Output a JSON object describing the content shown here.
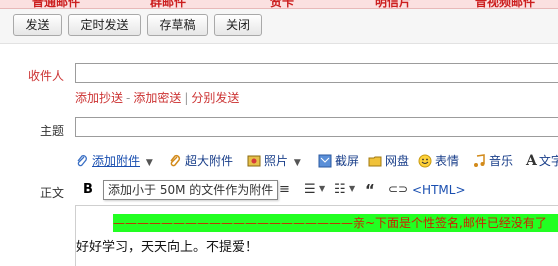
{
  "tabs": [
    "普通邮件",
    "群邮件",
    "贺卡",
    "明信片",
    "音视频邮件"
  ],
  "toolbar": {
    "send": "发送",
    "timed_send": "定时发送",
    "save_draft": "存草稿",
    "close": "关闭"
  },
  "form": {
    "recipient_label": "收件人",
    "add_cc": "添加抄送",
    "add_bcc": "添加密送",
    "separate_send": "分别发送",
    "subject_label": "主题",
    "body_label": "正文"
  },
  "attachments": {
    "add_attachment": "添加附件",
    "large_attachment": "超大附件",
    "photo": "照片",
    "screenshot": "截屏",
    "netdisk": "网盘",
    "emoji": "表情",
    "music": "音乐",
    "text": "文字"
  },
  "tooltip": "添加小于 50M 的文件作为附件",
  "editor": {
    "bold": "B",
    "html_link": "<HTML>",
    "signature_line": "————————————————————亲~下面是个性签名,邮件已经没有了",
    "body_text": "好好学习，天天向上。不提爱！"
  }
}
